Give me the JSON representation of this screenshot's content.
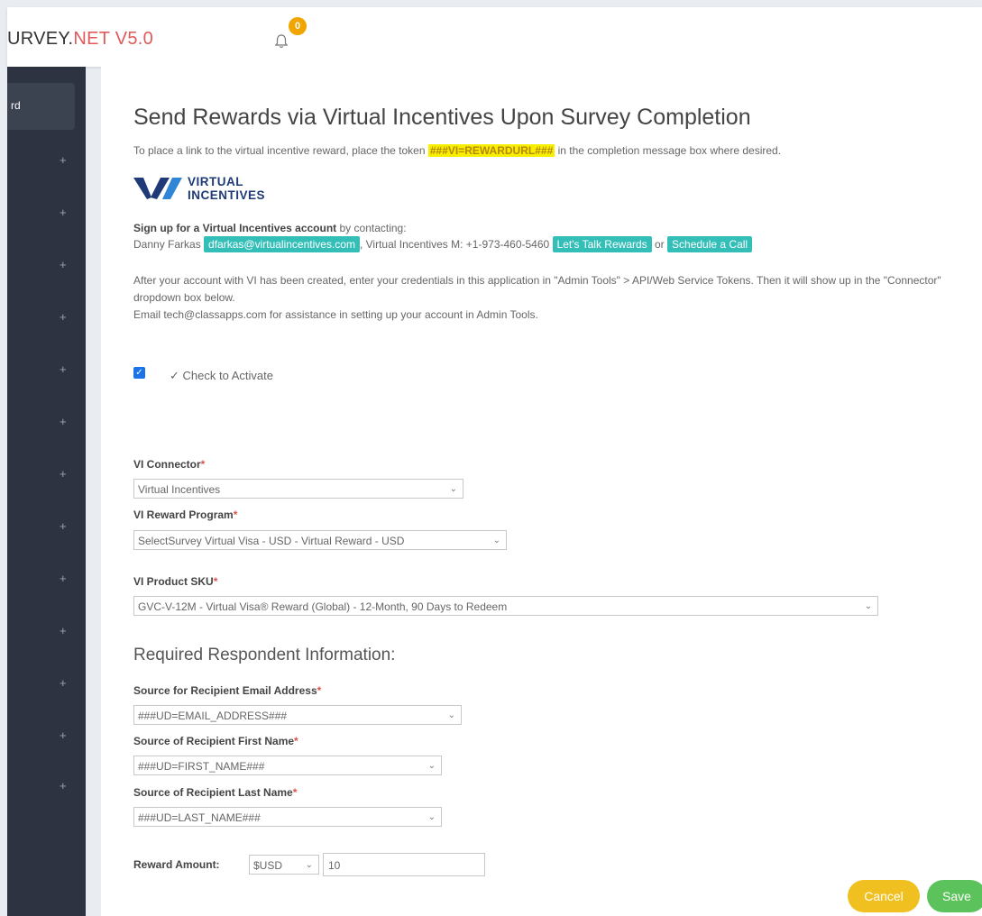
{
  "header": {
    "brand_prefix": "URVEY.",
    "brand_net": "NET",
    "brand_version": " V5.0",
    "notification_count": "0"
  },
  "sidebar": {
    "active_label": "rd",
    "expand_symbol": "+"
  },
  "page": {
    "title": "Send Rewards via Virtual Incentives Upon Survey Completion",
    "intro_before": "To place a link to the virtual incentive reward, place the token ",
    "token": "###VI=REWARDURL###",
    "intro_after": " in the completion message box where desired.",
    "logo_line1": "VIRTUAL",
    "logo_line2": "INCENTIVES",
    "signup_bold": "Sign up for a Virtual Incentives account",
    "signup_rest": " by contacting:",
    "contact_name": "Danny Farkas",
    "contact_email": "dfarkas@virtualincentives.com",
    "contact_phone": ", Virtual Incentives M: +1-973-460-5460",
    "lets_talk": "Let's Talk Rewards",
    "or_text": " or ",
    "schedule_call": "Schedule a Call",
    "after_p1": "After your account with VI has been created, enter your credentials in this application in \"Admin Tools\" > API/Web Service Tokens. Then it will show up in the \"Connector\" dropdown box below.",
    "after_p2": "Email tech@classapps.com for assistance in setting up your account in Admin Tools.",
    "activate_label": "✓ Check to Activate"
  },
  "form": {
    "connector_label": "VI Connector",
    "connector_value": "Virtual Incentives",
    "program_label": "VI Reward Program",
    "program_value": "SelectSurvey Virtual Visa - USD - Virtual Reward - USD",
    "sku_label": "VI Product SKU",
    "sku_value": "GVC-V-12M - Virtual Visa® Reward (Global) - 12-Month, 90 Days to Redeem",
    "respondent_heading": "Required Respondent Information:",
    "email_label": "Source for Recipient Email Address",
    "email_value": "###UD=EMAIL_ADDRESS###",
    "first_label": "Source of Recipient First Name",
    "first_value": "###UD=FIRST_NAME###",
    "last_label": "Source of Recipient Last Name",
    "last_value": "###UD=LAST_NAME###",
    "amount_label": "Reward Amount:",
    "currency_value": "$USD",
    "amount_value": "10",
    "required_mark": "*"
  },
  "actions": {
    "cancel": "Cancel",
    "save": "Save"
  },
  "colors": {
    "sidebar": "#2d3340",
    "token_highlight": "#f6f000",
    "teal_tag": "#33bfb8",
    "cancel": "#f0c020",
    "save": "#5cc25c",
    "brand_accent": "#e05a5a",
    "logo_blue": "#1f3a78"
  }
}
